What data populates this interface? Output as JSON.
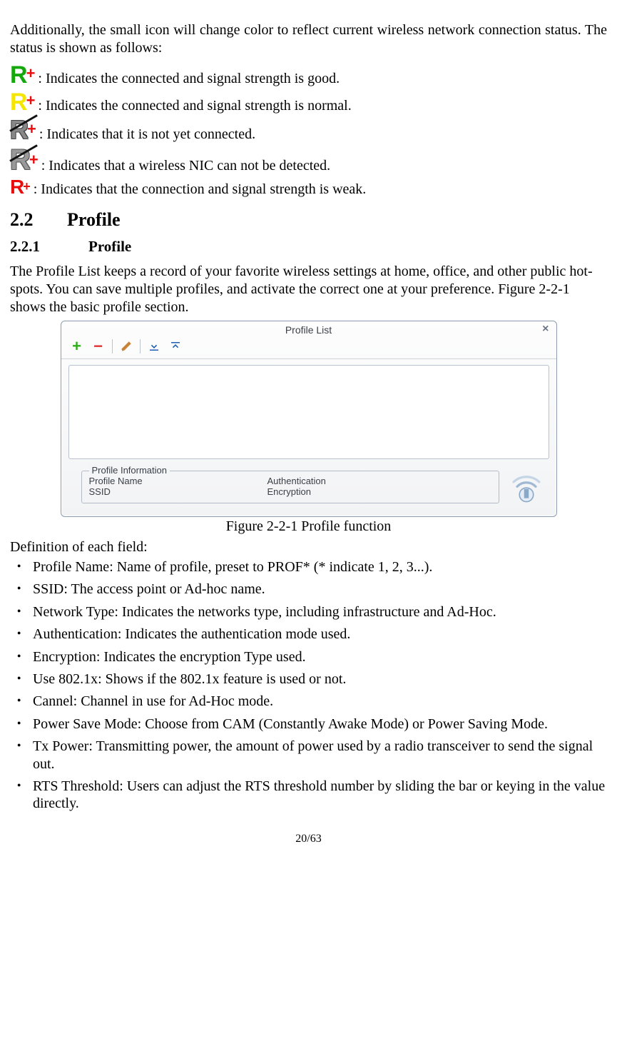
{
  "intro": "Additionally, the small icon will change color to reflect current wireless network connection status. The status is shown as follows:",
  "statuses": {
    "s1": ": Indicates the connected and signal strength is good.",
    "s2": ": Indicates the connected and signal strength is normal.",
    "s3": ": Indicates that it is not yet connected.",
    "s4": ": Indicates that a wireless NIC can not be detected.",
    "s5": ": Indicates that the connection and signal strength is weak."
  },
  "section": {
    "num": "2.2",
    "title": "Profile"
  },
  "subsection": {
    "num": "2.2.1",
    "title": "Profile"
  },
  "profile_desc": "The Profile List keeps a record of your favorite wireless settings at home, office, and other public hot-spots. You can save multiple profiles, and activate the correct one at your preference. Figure 2-2-1 shows the basic profile section.",
  "window": {
    "title": "Profile List",
    "legend": "Profile Information",
    "row1a": "Profile Name",
    "row1b": "Authentication",
    "row2a": "SSID",
    "row2b": "Encryption"
  },
  "caption": "Figure 2-2-1 Profile function",
  "defn_head": "Definition of each field:",
  "fields": {
    "f0": "Profile Name: Name of profile, preset to PROF* (* indicate 1, 2, 3...).",
    "f1": "SSID:   The access point or Ad-hoc name.",
    "f2": "Network Type: Indicates the networks type, including infrastructure and Ad-Hoc.",
    "f3": "Authentication: Indicates the authentication mode used.",
    "f4": "Encryption: Indicates the encryption Type used.",
    "f5": "Use 802.1x: Shows if the 802.1x feature is used or not.",
    "f6": "Cannel: Channel in use for Ad-Hoc mode.",
    "f7": "Power Save Mode: Choose from CAM (Constantly Awake Mode) or Power Saving Mode.",
    "f8": "Tx Power: Transmitting power, the amount of power used by a radio transceiver to send the signal out.",
    "f9": "RTS Threshold: Users can adjust the RTS threshold number by sliding the bar or keying in the value directly."
  },
  "pagenum": "20/63"
}
